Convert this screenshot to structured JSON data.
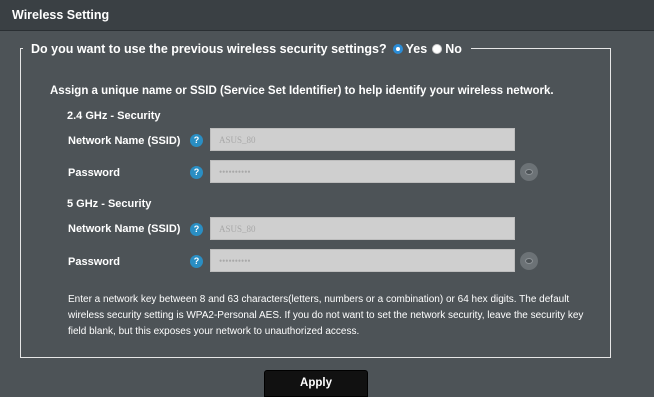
{
  "header": {
    "title": "Wireless Setting"
  },
  "question": {
    "text": "Do you want to use the previous wireless security settings?",
    "options": [
      {
        "label": "Yes",
        "selected": true
      },
      {
        "label": "No",
        "selected": false
      }
    ]
  },
  "intro": "Assign a unique name or SSID (Service Set Identifier) to help identify your wireless network.",
  "bands": [
    {
      "title": "2.4 GHz - Security",
      "ssid_label": "Network Name (SSID)",
      "ssid_value": "ASUS_80",
      "password_label": "Password",
      "password_value": "••••••••••"
    },
    {
      "title": "5 GHz - Security",
      "ssid_label": "Network Name (SSID)",
      "ssid_value": "ASUS_80",
      "password_label": "Password",
      "password_value": "••••••••••"
    }
  ],
  "help_glyph": "?",
  "note": "Enter a network key between 8 and 63 characters(letters, numbers or a combination) or 64 hex digits. The default wireless security setting is WPA2-Personal AES. If you do not want to set the network security, leave the security key field blank, but this exposes your network to unauthorized access.",
  "apply_label": "Apply",
  "colors": {
    "accent": "#2a8ec3",
    "background": "#4d5357",
    "input": "#cfcfcf"
  }
}
